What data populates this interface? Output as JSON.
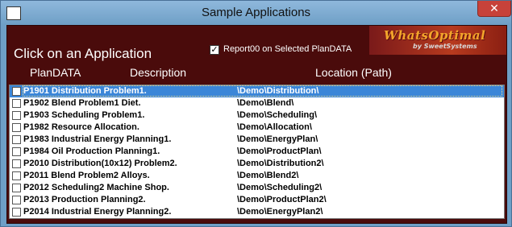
{
  "window": {
    "title": "Sample Applications",
    "close_label": "✕"
  },
  "header": {
    "prompt": "Click on an Application",
    "col_plandata": "PlanDATA",
    "col_description": "Description",
    "col_location": "Location (Path)",
    "report_checkbox_label": "Report00 on Selected PlanDATA",
    "report_checked": true,
    "report_check_glyph": "✓"
  },
  "logo": {
    "main": "WhatsOptimal",
    "sub": "by SweetSystems"
  },
  "applications": [
    {
      "code": "P1901 Distribution Problem1.",
      "path": "\\Demo\\Distribution\\",
      "selected": true
    },
    {
      "code": "P1902 Blend Problem1 Diet.",
      "path": "\\Demo\\Blend\\"
    },
    {
      "code": "P1903 Scheduling Problem1.",
      "path": "\\Demo\\Scheduling\\"
    },
    {
      "code": "P1982 Resource Allocation.",
      "path": "\\Demo\\Allocation\\"
    },
    {
      "code": "P1983 Industrial Energy Planning1.",
      "path": "\\Demo\\EnergyPlan\\"
    },
    {
      "code": "P1984 Oil Production Planning1.",
      "path": "\\Demo\\ProductPlan\\"
    },
    {
      "code": "P2010 Distribution(10x12) Problem2.",
      "path": "\\Demo\\Distribution2\\"
    },
    {
      "code": "P2011 Blend Problem2 Alloys.",
      "path": "\\Demo\\Blend2\\"
    },
    {
      "code": "P2012 Scheduling2 Machine Shop.",
      "path": "\\Demo\\Scheduling2\\"
    },
    {
      "code": "P2013 Production Planning2.",
      "path": "\\Demo\\ProductPlan2\\"
    },
    {
      "code": "P2014 Industrial Energy Planning2.",
      "path": "\\Demo\\EnergyPlan2\\"
    }
  ]
}
